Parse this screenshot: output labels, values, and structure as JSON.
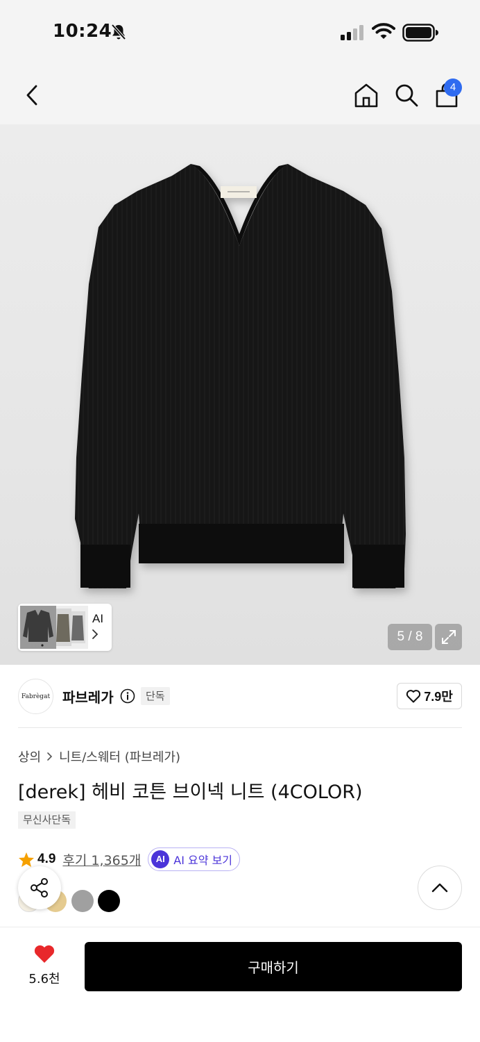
{
  "status_bar": {
    "time": "10:24",
    "icons": [
      "bell-slash-icon",
      "signal-icon",
      "wifi-icon",
      "battery-icon"
    ]
  },
  "nav": {
    "icons": [
      "back-icon",
      "home-icon",
      "search-icon",
      "cart-icon"
    ],
    "cart_badge": "4"
  },
  "gallery": {
    "ai_thumb_label": "AI",
    "page_indicator": "5 / 8",
    "expand_icon": "expand-icon"
  },
  "brand": {
    "logo_text": "Fabrègat",
    "name": "파브레가",
    "tag": "단독",
    "like_count": "7.9만"
  },
  "product": {
    "breadcrumb": [
      "상의",
      "니트/스웨터 (파브레가)"
    ],
    "title": "[derek] 헤비 코튼 브이넥 니트 (4COLOR)",
    "tag": "무신사단독",
    "rating": "4.9",
    "reviews": "후기 1,365개",
    "ai_badge": "AI",
    "ai_summary": "AI 요약 보기",
    "swatch_colors": [
      "#f4efe2",
      "#e5cb90",
      "#a0a0a0",
      "#000000"
    ]
  },
  "colors": {
    "accent_blue": "#2f6bf0",
    "ai_purple": "#4b34d9",
    "heart_red": "#e8282b",
    "rating_star": "#f5a000"
  },
  "bottom_bar": {
    "wish_count": "5.6천",
    "buy_label": "구매하기"
  }
}
